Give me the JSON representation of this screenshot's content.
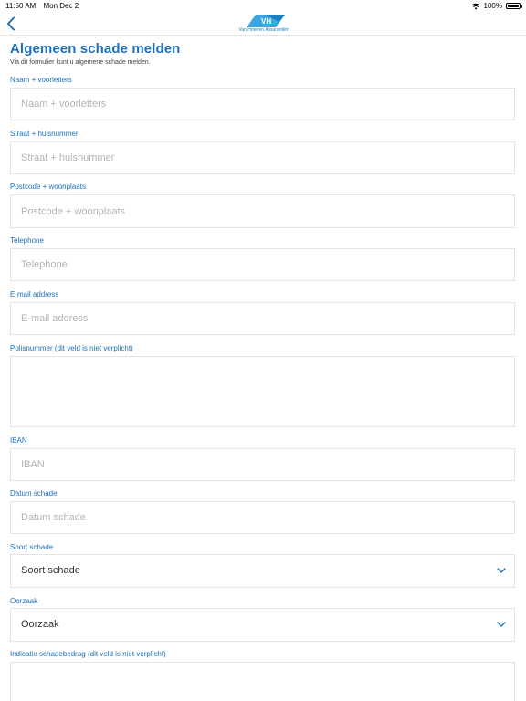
{
  "status_bar": {
    "time": "11:50 AM",
    "day": "Mon Dec 2",
    "battery": "100%"
  },
  "header": {
    "logo_text": "Van Hoteren Assurantiën",
    "accent_color": "#1e6fb5"
  },
  "page": {
    "title": "Algemeen schade melden",
    "subtitle": "Via dit formulier kunt u algemene schade melden."
  },
  "form": {
    "name": {
      "label": "Naam + voorletters",
      "placeholder": "Naam + voorletters",
      "value": ""
    },
    "street": {
      "label": "Straat + huisnummer",
      "placeholder": "Straat + huisnummer",
      "value": ""
    },
    "postcode": {
      "label": "Postcode + woonplaats",
      "placeholder": "Postcode + woonplaats",
      "value": ""
    },
    "telephone": {
      "label": "Telephone",
      "placeholder": "Telephone",
      "value": ""
    },
    "email": {
      "label": "E-mail address",
      "placeholder": "E-mail address",
      "value": ""
    },
    "policy": {
      "label": "Polisnummer (dit veld is niet verplicht)",
      "placeholder": "",
      "value": ""
    },
    "iban": {
      "label": "IBAN",
      "placeholder": "IBAN",
      "value": ""
    },
    "damage_date": {
      "label": "Datum schade",
      "placeholder": "Datum schade",
      "value": ""
    },
    "damage_type": {
      "label": "Soort schade",
      "selected": "Soort schade"
    },
    "cause": {
      "label": "Oorzaak",
      "selected": "Oorzaak"
    },
    "damage_amount": {
      "label": "Indicatie schadebedrag (dit veld is niet verplicht)",
      "placeholder": "",
      "value": ""
    }
  }
}
